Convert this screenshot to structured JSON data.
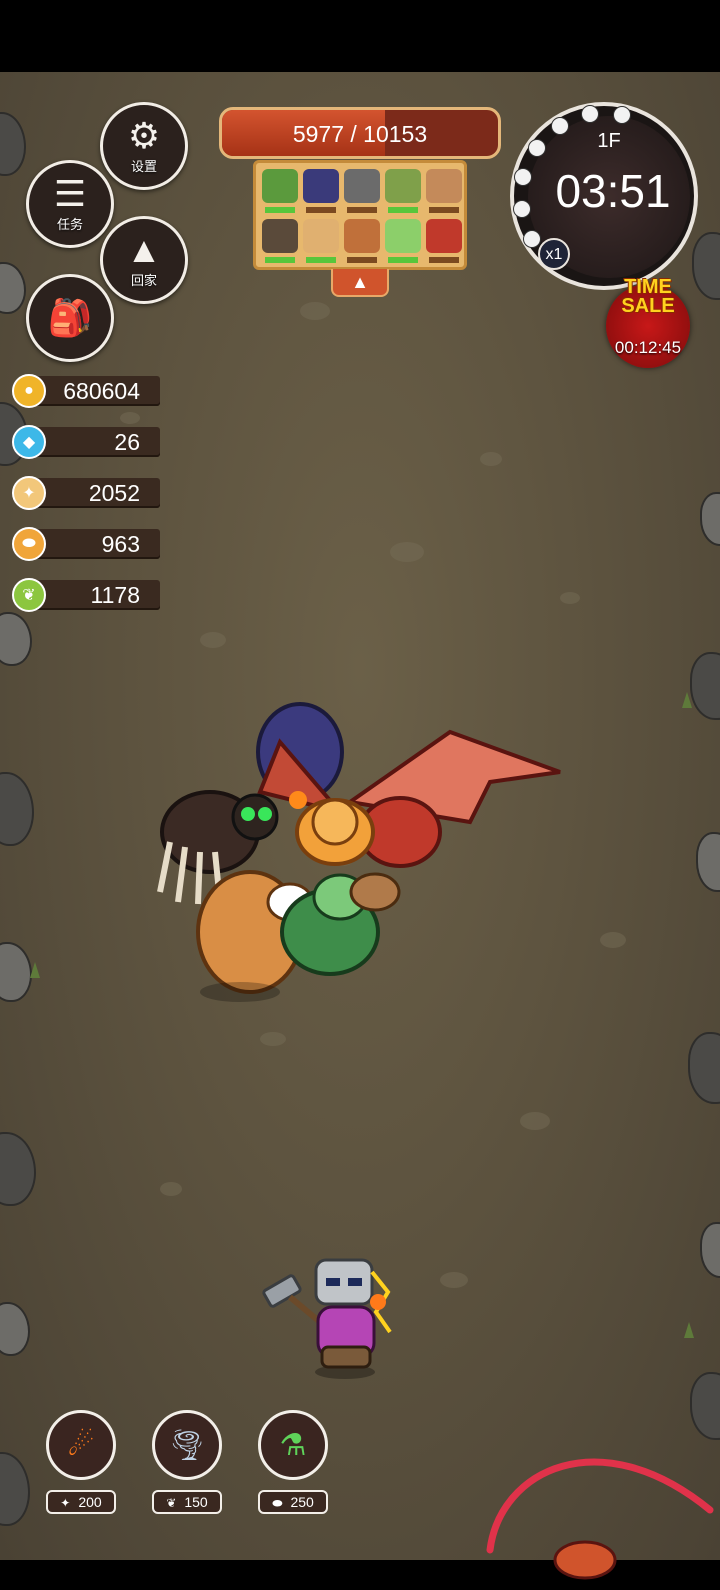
{
  "menu": {
    "settings_label": "设置",
    "tasks_label": "任务",
    "home_label": "回家",
    "icons": {
      "settings": "gear-icon",
      "tasks": "checklist-icon",
      "home": "mountain-icon",
      "bag": "backpack-icon"
    }
  },
  "boss": {
    "hp_text": "5977 / 10153",
    "hp_fraction": 0.589
  },
  "roster": {
    "members": [
      {
        "name": "frog",
        "color": "#5b9a3d",
        "hp": 1.0
      },
      {
        "name": "dragon-blue",
        "color": "#3a3a7a",
        "hp": 0.0
      },
      {
        "name": "rhino",
        "color": "#6b6b6b",
        "hp": 0.0
      },
      {
        "name": "lizard",
        "color": "#7fa04a",
        "hp": 1.0
      },
      {
        "name": "monkey",
        "color": "#c48a5a",
        "hp": 0.0
      },
      {
        "name": "spider",
        "color": "#5a4a3a",
        "hp": 1.0
      },
      {
        "name": "lion",
        "color": "#e0b070",
        "hp": 1.0
      },
      {
        "name": "wolf",
        "color": "#c0703a",
        "hp": 0.0
      },
      {
        "name": "mantis",
        "color": "#8ccf6a",
        "hp": 1.0
      },
      {
        "name": "dragon-red",
        "color": "#c0392b",
        "hp": 0.0
      }
    ],
    "toggle_icon": "▲"
  },
  "timer": {
    "floor": "1F",
    "time": "03:51",
    "speed": "x1"
  },
  "sale": {
    "title_line1": "TIME",
    "title_line2": "SALE",
    "countdown": "00:12:45"
  },
  "resources": [
    {
      "id": "gold",
      "value": "680604",
      "color": "#f0b429",
      "icon": "coin-icon"
    },
    {
      "id": "gem",
      "value": "26",
      "color": "#3db8e8",
      "icon": "gem-icon"
    },
    {
      "id": "bone",
      "value": "2052",
      "color": "#f2c77a",
      "icon": "bone-icon"
    },
    {
      "id": "pill",
      "value": "963",
      "color": "#f0a53a",
      "icon": "capsule-icon"
    },
    {
      "id": "herb",
      "value": "1178",
      "color": "#8cc63f",
      "icon": "herb-icon"
    }
  ],
  "skills": [
    {
      "id": "meteor",
      "icon": "meteor-icon",
      "cost": "200",
      "cost_icon": "bone-icon"
    },
    {
      "id": "tornado",
      "icon": "tornado-icon",
      "cost": "150",
      "cost_icon": "herb-icon"
    },
    {
      "id": "potion",
      "icon": "potion-icon",
      "cost": "250",
      "cost_icon": "capsule-icon"
    }
  ]
}
